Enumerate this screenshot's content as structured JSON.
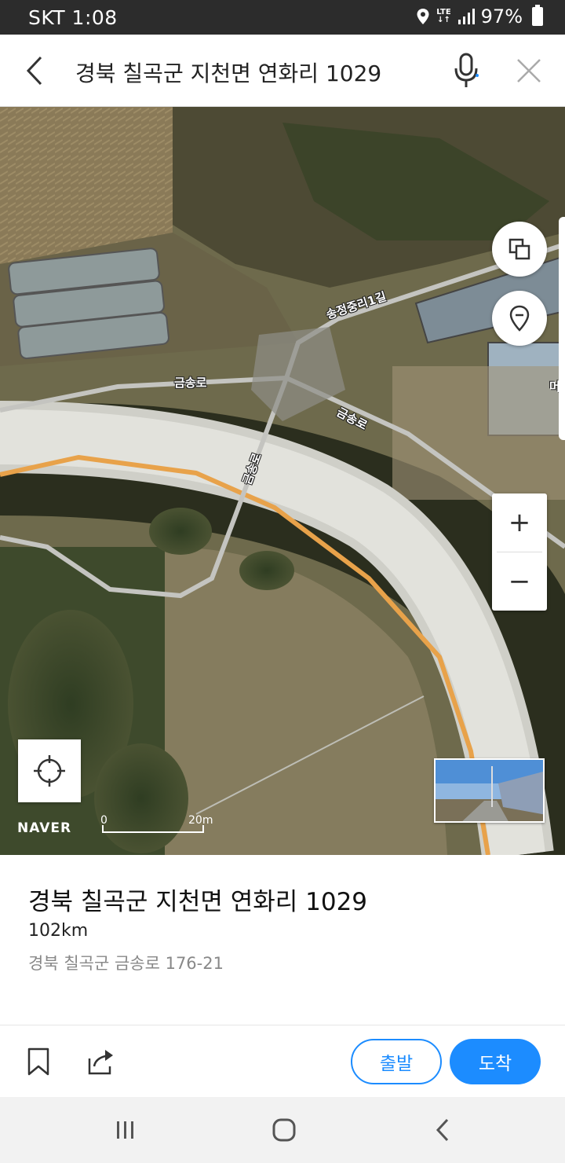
{
  "status_bar": {
    "carrier_time": "SKT 1:08",
    "network": "LTE",
    "battery": "97%"
  },
  "search": {
    "query": "경북 칠곡군 지천면 연화리 1029"
  },
  "map": {
    "road_labels": [
      "송정중리1길",
      "금송로",
      "금송로",
      "금송로"
    ],
    "edge_char": "머",
    "zoom_in": "+",
    "zoom_out": "−",
    "brand": "NAVER",
    "scale_start": "0",
    "scale_end": "20m"
  },
  "place": {
    "title": "경북 칠곡군 지천면 연화리 1029",
    "distance": "102km",
    "address": "경북 칠곡군 금송로 176-21"
  },
  "actions": {
    "depart": "출발",
    "arrive": "도착"
  },
  "colors": {
    "accent": "#1c8cff",
    "route_line": "#e8a24a"
  }
}
